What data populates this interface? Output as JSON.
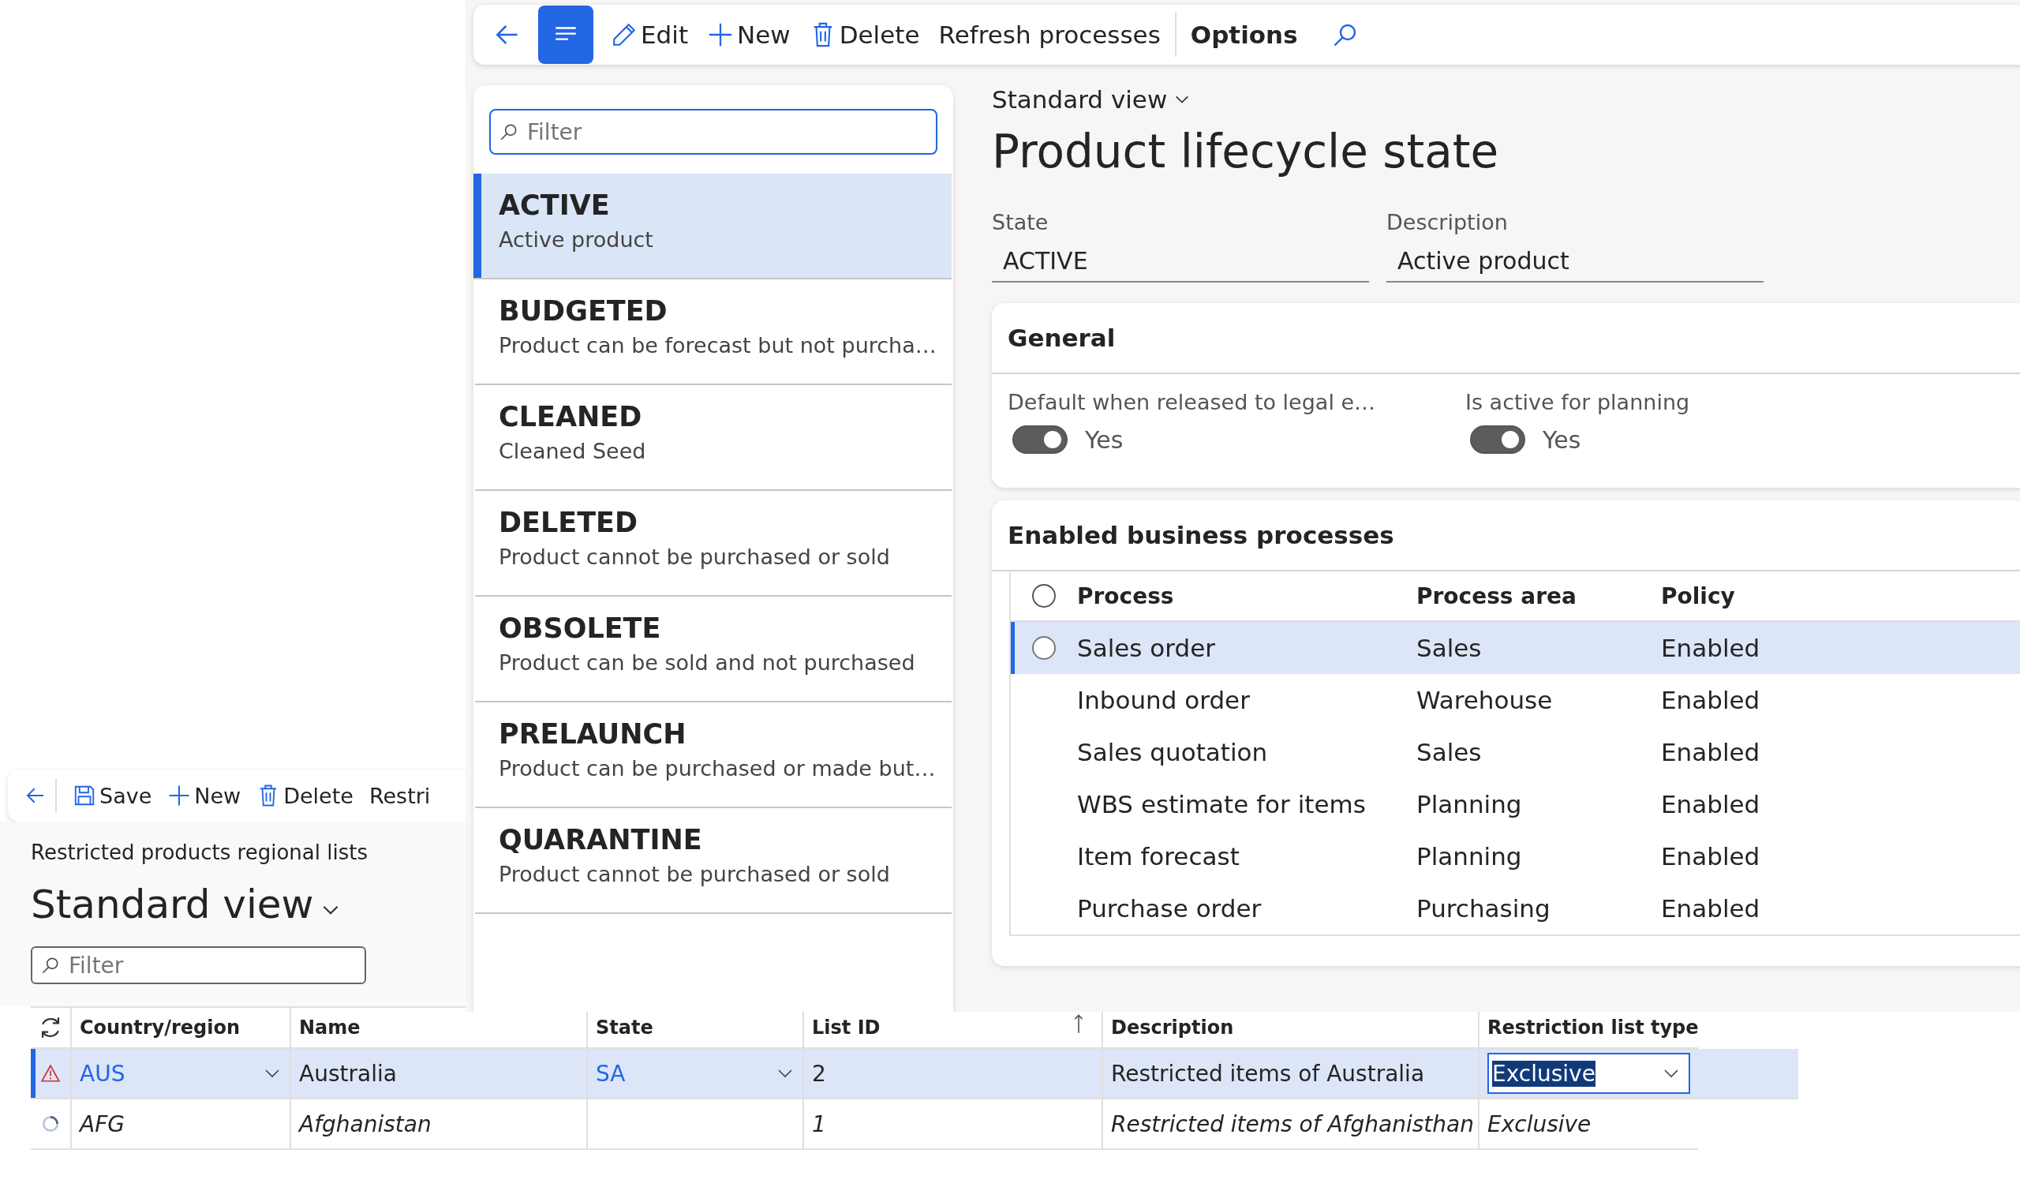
{
  "main_window": {
    "toolbar": {
      "list_toggle": {
        "selected": true
      },
      "buttons": [
        {
          "kind": "edit",
          "label": "Edit"
        },
        {
          "kind": "new",
          "label": "New"
        },
        {
          "kind": "delete",
          "label": "Delete"
        },
        {
          "kind": "refresh",
          "label": "Refresh processes"
        },
        {
          "kind": "options",
          "label": "Options"
        }
      ]
    },
    "list": {
      "filter_placeholder": "Filter",
      "items": [
        {
          "title": "ACTIVE",
          "subtitle": "Active product",
          "selected": true
        },
        {
          "title": "BUDGETED",
          "subtitle": "Product can be forecast but not purcha…",
          "selected": false
        },
        {
          "title": "CLEANED",
          "subtitle": "Cleaned Seed",
          "selected": false
        },
        {
          "title": "DELETED",
          "subtitle": "Product cannot be purchased or sold",
          "selected": false
        },
        {
          "title": "OBSOLETE",
          "subtitle": "Product can be sold and not purchased",
          "selected": false
        },
        {
          "title": "PRELAUNCH",
          "subtitle": "Product can be purchased or made but…",
          "selected": false
        },
        {
          "title": "QUARANTINE",
          "subtitle": "Product cannot be purchased or sold",
          "selected": false
        }
      ]
    },
    "view_name": "Standard view",
    "title": "Product lifecycle state",
    "fields": [
      {
        "label": "State",
        "value": "ACTIVE"
      },
      {
        "label": "Description",
        "value": "Active product"
      }
    ],
    "general": {
      "title": "General",
      "toggles": [
        {
          "label": "Default when released to legal e…",
          "on": true,
          "value": "Yes"
        },
        {
          "label": "Is active for planning",
          "on": true,
          "value": "Yes"
        }
      ]
    },
    "processes": {
      "title": "Enabled business processes",
      "all_selected": false,
      "columns": [
        "Process",
        "Process area",
        "Policy"
      ],
      "rows": [
        {
          "process": "Sales order",
          "area": "Sales",
          "policy": "Enabled",
          "selected": true
        },
        {
          "process": "Inbound order",
          "area": "Warehouse",
          "policy": "Enabled",
          "selected": false
        },
        {
          "process": "Sales quotation",
          "area": "Sales",
          "policy": "Enabled",
          "selected": false
        },
        {
          "process": "WBS estimate for items",
          "area": "Planning",
          "policy": "Enabled",
          "selected": false
        },
        {
          "process": "Item forecast",
          "area": "Planning",
          "policy": "Enabled",
          "selected": false
        },
        {
          "process": "Purchase order",
          "area": "Purchasing",
          "policy": "Enabled",
          "selected": false
        }
      ]
    }
  },
  "back_window": {
    "toolbar": [
      {
        "kind": "save",
        "label": "Save"
      },
      {
        "kind": "new",
        "label": "New"
      },
      {
        "kind": "delete",
        "label": "Delete"
      },
      {
        "kind": "text",
        "label": "Restri"
      }
    ],
    "breadcrumb": "Restricted products regional lists",
    "view_name": "Standard view",
    "filter_placeholder": "Filter",
    "grid": {
      "columns": [
        {
          "label": "Country/region"
        },
        {
          "label": "Name"
        },
        {
          "label": "State"
        },
        {
          "label": "List ID",
          "sorted": true
        },
        {
          "label": "Description"
        },
        {
          "label": "Restriction list type"
        }
      ],
      "rows": [
        {
          "kind": "warning",
          "country": "AUS",
          "name": "Australia",
          "state": "SA",
          "list_id": "2",
          "description": "Restricted items of Australia",
          "type": "Exclusive",
          "selected": true,
          "pending": false
        },
        {
          "kind": "loading",
          "country": "AFG",
          "name": "Afghanistan",
          "list_id": "1",
          "description": "Restricted items of Afghanisthan",
          "type": "Exclusive",
          "selected": false,
          "pending": true
        }
      ]
    }
  }
}
